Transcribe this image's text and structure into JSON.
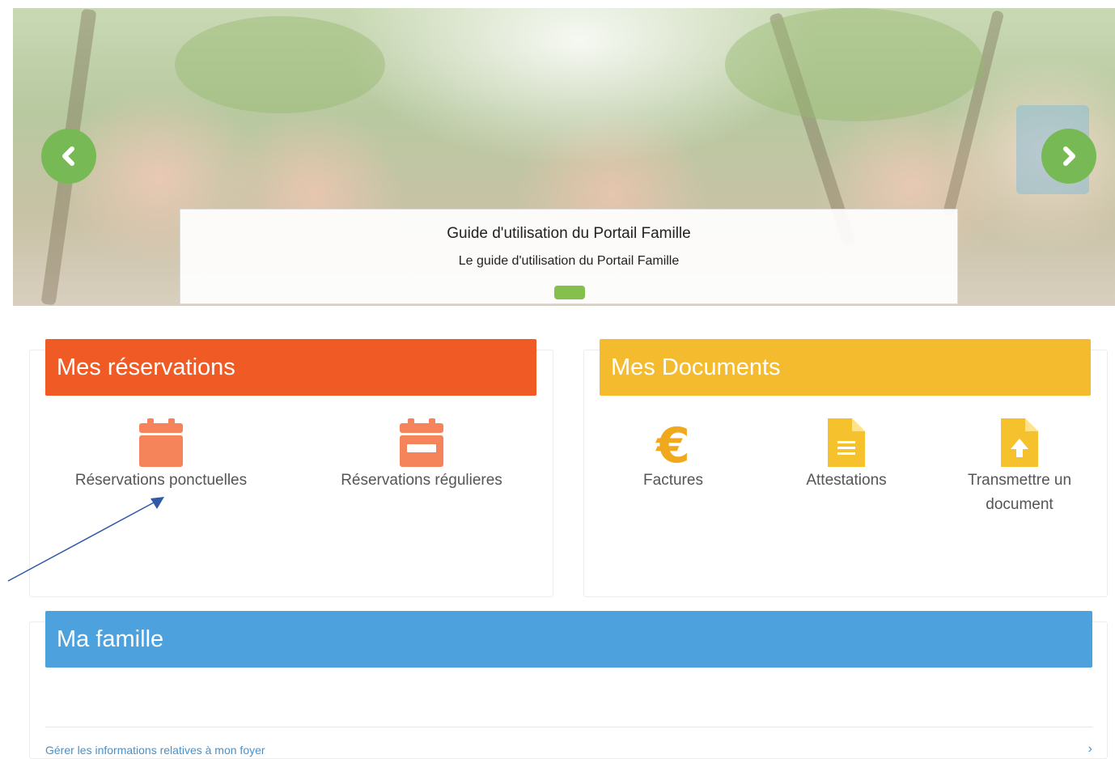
{
  "banner": {
    "slide_title": "Guide d'utilisation du Portail Famille",
    "slide_subtitle": "Le guide d'utilisation du Portail Famille",
    "prev_icon": "chevron-left-icon",
    "next_icon": "chevron-right-icon",
    "accent": "#77b955"
  },
  "reservations": {
    "title": "Mes réservations",
    "color": "#f05a24",
    "items": [
      {
        "label": "Réservations ponctuelles",
        "icon": "calendar-icon"
      },
      {
        "label": "Réservations régulieres",
        "icon": "calendar-minus-icon"
      }
    ]
  },
  "documents": {
    "title": "Mes Documents",
    "color": "#f4bb2f",
    "items": [
      {
        "label": "Factures",
        "icon": "euro-icon"
      },
      {
        "label": "Attestations",
        "icon": "file-text-icon"
      },
      {
        "label": "Transmettre un document",
        "icon": "file-upload-icon"
      }
    ]
  },
  "family": {
    "title": "Ma famille",
    "color": "#4da1dd",
    "link": "Gérer les informations relatives à mon foyer"
  }
}
